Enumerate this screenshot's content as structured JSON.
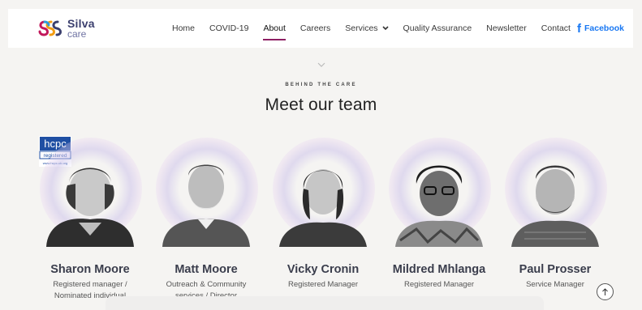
{
  "header": {
    "logo": {
      "line1": "Silva",
      "line2": "care"
    },
    "nav": [
      {
        "label": "Home"
      },
      {
        "label": "COVID-19"
      },
      {
        "label": "About",
        "active": true
      },
      {
        "label": "Careers"
      },
      {
        "label": "Services",
        "has_dropdown": true
      },
      {
        "label": "Quality Assurance"
      },
      {
        "label": "Newsletter"
      },
      {
        "label": "Contact"
      }
    ],
    "social": {
      "icon": "facebook-icon",
      "label": "Facebook"
    }
  },
  "hero": {
    "eyebrow": "BEHIND THE CARE",
    "title": "Meet our team"
  },
  "badge": {
    "line1": "hcpc",
    "line2": "registered",
    "line3": "www.hcpc-uk.org"
  },
  "team": [
    {
      "name": "Sharon Moore",
      "role_line1": "Registered manager /",
      "role_line2": "Nominated individual"
    },
    {
      "name": "Matt Moore",
      "role_line1": "Outreach & Community",
      "role_line2": "services / Director"
    },
    {
      "name": "Vicky Cronin",
      "role_line1": "Registered Manager",
      "role_line2": ""
    },
    {
      "name": "Mildred Mhlanga",
      "role_line1": "Registered Manager",
      "role_line2": ""
    },
    {
      "name": "Paul Prosser",
      "role_line1": "Service Manager",
      "role_line2": ""
    }
  ],
  "colors": {
    "accent": "#8e1f63",
    "facebook": "#1877f2",
    "brand_dark": "#3b3f6e",
    "brand_light": "#6f73a3"
  }
}
